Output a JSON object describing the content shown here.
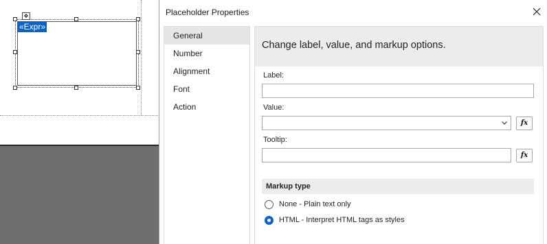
{
  "designer": {
    "expression_text": "«Expr»"
  },
  "dialog": {
    "title": "Placeholder Properties",
    "nav_items": [
      {
        "label": "General",
        "selected": true
      },
      {
        "label": "Number",
        "selected": false
      },
      {
        "label": "Alignment",
        "selected": false
      },
      {
        "label": "Font",
        "selected": false
      },
      {
        "label": "Action",
        "selected": false
      }
    ],
    "header": "Change label, value, and markup options.",
    "label_field": {
      "label": "Label:",
      "value": ""
    },
    "value_field": {
      "label": "Value:",
      "value": ""
    },
    "tooltip_field": {
      "label": "Tooltip:",
      "value": ""
    },
    "fx_label": "fx",
    "markup": {
      "section_title": "Markup type",
      "options": [
        {
          "label": "None - Plain text only",
          "checked": false
        },
        {
          "label": "HTML - Interpret HTML tags as styles",
          "checked": true
        }
      ]
    }
  },
  "colors": {
    "accent": "#0a64c8",
    "surface_dark": "#6e6e6e"
  }
}
